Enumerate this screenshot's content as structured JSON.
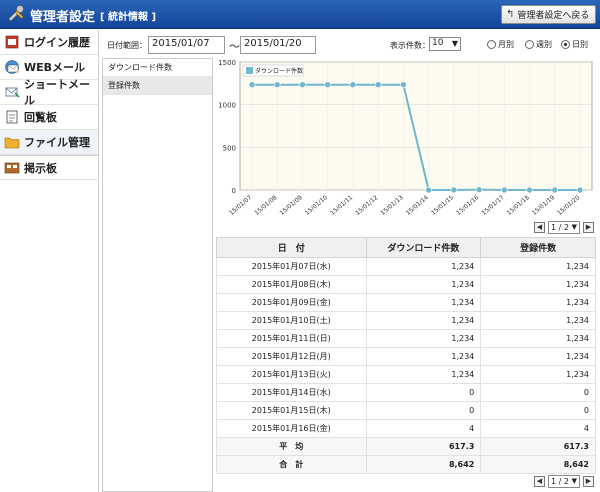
{
  "header": {
    "title": "管理者設定",
    "subtitle": "[ 統計情報 ]",
    "back_button": "管理者設定へ戻る"
  },
  "sidebar": {
    "items": [
      {
        "label": "ログイン履歴",
        "icon": "login-history-icon"
      },
      {
        "label": "WEBメール",
        "icon": "webmail-icon"
      },
      {
        "label": "ショートメール",
        "icon": "short-mail-icon"
      },
      {
        "label": "回覧板",
        "icon": "circular-board-icon"
      },
      {
        "label": "ファイル管理",
        "icon": "folder-icon",
        "active": true
      },
      {
        "label": "掲示板",
        "icon": "bulletin-board-icon"
      }
    ]
  },
  "filter": {
    "date_label": "日付範囲：",
    "date_from": "2015/01/07",
    "tilde": "～",
    "date_to": "2015/01/20",
    "display_label": "表示件数：",
    "display_count": "10",
    "radio_monthly": "月別",
    "radio_weekly": "週別",
    "radio_daily": "日別",
    "selected": "daily"
  },
  "categories": [
    {
      "label": "ダウンロード件数",
      "selected": false
    },
    {
      "label": "登録件数",
      "selected": true
    }
  ],
  "chart_data": {
    "type": "line",
    "x": [
      "15/01/07",
      "15/01/08",
      "15/01/09",
      "15/01/10",
      "15/01/11",
      "15/01/12",
      "15/01/13",
      "15/01/14",
      "15/01/15",
      "15/01/16",
      "15/01/17",
      "15/01/18",
      "15/01/19",
      "15/01/20"
    ],
    "series": [
      {
        "name": "ダウンロード件数",
        "values": [
          1234,
          1234,
          1234,
          1234,
          1234,
          1234,
          1234,
          0,
          0,
          4,
          0,
          0,
          0,
          0
        ]
      }
    ],
    "yticks": [
      0,
      500,
      1000,
      1500
    ],
    "ylim": [
      0,
      1500
    ],
    "legend": "top-left",
    "grid": true,
    "line_color": "#6fb8cc"
  },
  "pager": {
    "page": "1 / 2",
    "prev": "◀",
    "next": "▶"
  },
  "table": {
    "headers": [
      "日　付",
      "ダウンロード件数",
      "登録件数"
    ],
    "rows": [
      [
        "2015年01月07日(水)",
        "1,234",
        "1,234"
      ],
      [
        "2015年01月08日(木)",
        "1,234",
        "1,234"
      ],
      [
        "2015年01月09日(金)",
        "1,234",
        "1,234"
      ],
      [
        "2015年01月10日(土)",
        "1,234",
        "1,234"
      ],
      [
        "2015年01月11日(日)",
        "1,234",
        "1,234"
      ],
      [
        "2015年01月12日(月)",
        "1,234",
        "1,234"
      ],
      [
        "2015年01月13日(火)",
        "1,234",
        "1,234"
      ],
      [
        "2015年01月14日(水)",
        "0",
        "0"
      ],
      [
        "2015年01月15日(木)",
        "0",
        "0"
      ],
      [
        "2015年01月16日(金)",
        "4",
        "4"
      ]
    ],
    "average": [
      "平　均",
      "617.3",
      "617.3"
    ],
    "total": [
      "合　計",
      "8,642",
      "8,642"
    ]
  }
}
